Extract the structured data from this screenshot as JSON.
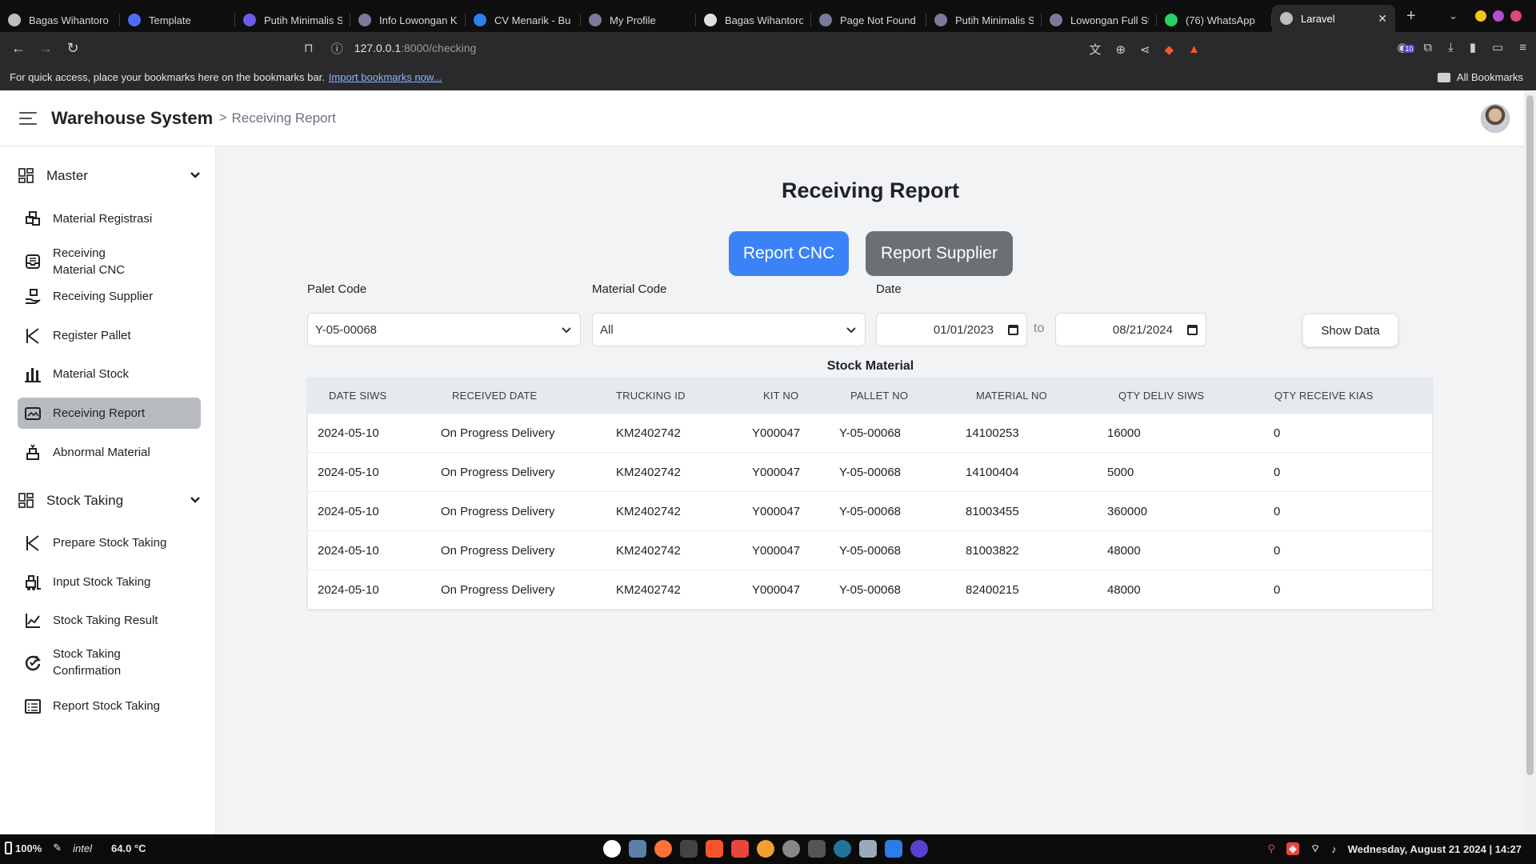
{
  "browser": {
    "tabs": [
      {
        "title": "Bagas Wihantoro",
        "color": "#bdbdbd"
      },
      {
        "title": "Template",
        "color": "#4f6ef7"
      },
      {
        "title": "Putih Minimalis S",
        "color": "#6c5ce7"
      },
      {
        "title": "Info Lowongan K",
        "color": "#7a7a9a"
      },
      {
        "title": "CV Menarik - Bu",
        "color": "#2f80ed"
      },
      {
        "title": "My Profile",
        "color": "#7a7a9a"
      },
      {
        "title": "Bagas Wihantoro",
        "color": "#e0e0e0"
      },
      {
        "title": "Page Not Found",
        "color": "#7a7a9a"
      },
      {
        "title": "Putih Minimalis S",
        "color": "#7a7a9a"
      },
      {
        "title": "Lowongan Full St",
        "color": "#7a7a9a"
      },
      {
        "title": "(76) WhatsApp",
        "color": "#25d366"
      },
      {
        "title": "Laravel",
        "color": "#bdbdbd"
      }
    ],
    "url_host": "127.0.0.1",
    "url_path": ":8000/checking",
    "bookmarks_text": "For quick access, place your bookmarks here on the bookmarks bar.",
    "bookmarks_link": "Import bookmarks now...",
    "all_bookmarks": "All Bookmarks",
    "ext_badge": "10"
  },
  "header": {
    "app_title": "Warehouse System",
    "crumb_sep": ">",
    "crumb": "Receiving Report"
  },
  "sidebar": {
    "master": {
      "label": "Master",
      "items": [
        {
          "label": "Material Registrasi",
          "icon": "boxes-icon"
        },
        {
          "label": "Receiving Material CNC",
          "icon": "inbox-icon"
        },
        {
          "label": "Receiving Supplier",
          "icon": "hand-box-icon"
        },
        {
          "label": "Register Pallet",
          "icon": "skip-back-icon"
        },
        {
          "label": "Material Stock",
          "icon": "bar-chart-icon"
        },
        {
          "label": "Receiving Report",
          "icon": "image-report-icon",
          "active": true
        },
        {
          "label": "Abnormal Material",
          "icon": "stacked-box-icon"
        }
      ]
    },
    "stock_taking": {
      "label": "Stock Taking",
      "items": [
        {
          "label": "Prepare Stock Taking",
          "icon": "skip-back-icon"
        },
        {
          "label": "Input Stock Taking",
          "icon": "forklift-icon"
        },
        {
          "label": "Stock Taking Result",
          "icon": "line-chart-icon"
        },
        {
          "label": "Stock Taking Confirmation",
          "icon": "refresh-check-icon"
        },
        {
          "label": "Report Stock Taking",
          "icon": "list-report-icon"
        }
      ]
    }
  },
  "main": {
    "title": "Receiving Report",
    "btn_cnc": "Report CNC",
    "btn_supplier": "Report Supplier",
    "palet_label": "Palet Code",
    "palet_value": "Y-05-00068",
    "material_label": "Material Code",
    "material_value": "All",
    "date_label": "Date",
    "date_from": "01/01/2023",
    "date_to_word": "to",
    "date_to": "08/21/2024",
    "show_data": "Show Data",
    "table_title": "Stock Material",
    "columns": [
      "DATE SIWS",
      "RECEIVED DATE",
      "TRUCKING ID",
      "KIT NO",
      "PALLET NO",
      "MATERIAL NO",
      "QTY DELIV SIWS",
      "QTY RECEIVE KIAS"
    ],
    "rows": [
      [
        "2024-05-10",
        "On Progress Delivery",
        "KM2402742",
        "Y000047",
        "Y-05-00068",
        "14100253",
        "16000",
        "0"
      ],
      [
        "2024-05-10",
        "On Progress Delivery",
        "KM2402742",
        "Y000047",
        "Y-05-00068",
        "14100404",
        "5000",
        "0"
      ],
      [
        "2024-05-10",
        "On Progress Delivery",
        "KM2402742",
        "Y000047",
        "Y-05-00068",
        "81003455",
        "360000",
        "0"
      ],
      [
        "2024-05-10",
        "On Progress Delivery",
        "KM2402742",
        "Y000047",
        "Y-05-00068",
        "81003822",
        "48000",
        "0"
      ],
      [
        "2024-05-10",
        "On Progress Delivery",
        "KM2402742",
        "Y000047",
        "Y-05-00068",
        "82400215",
        "48000",
        "0"
      ]
    ]
  },
  "taskbar": {
    "battery": "100%",
    "cpu_brand": "intel",
    "temp": "64.0 °C",
    "datetime": "Wednesday, August 21 2024 | 14:27"
  },
  "colors": {
    "primary": "#3b82f6",
    "secondary": "#6b7075",
    "active_item": "#b8bcc1"
  }
}
